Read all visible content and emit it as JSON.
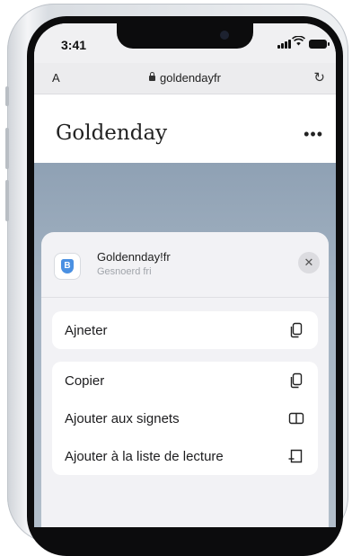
{
  "status_bar": {
    "time": "3:41"
  },
  "address_bar": {
    "aa_label": "A",
    "url": "goldendayfr",
    "reload_glyph": "↻"
  },
  "site": {
    "title": "Goldenday",
    "menu_glyph": "•••"
  },
  "share_sheet": {
    "title": "Goldennday!fr",
    "subtitle": "Gesnoerd fri",
    "close_glyph": "✕",
    "app_icon_glyph": "B",
    "top_action": {
      "label": "Ajneter",
      "icon": "copy-icon"
    },
    "actions": [
      {
        "label": "Copier",
        "icon": "copy-icon"
      },
      {
        "label": "Ajouter aux signets",
        "icon": "book-icon"
      },
      {
        "label": "Ajouter à la liste de lecture",
        "icon": "reading-list-icon"
      }
    ]
  }
}
